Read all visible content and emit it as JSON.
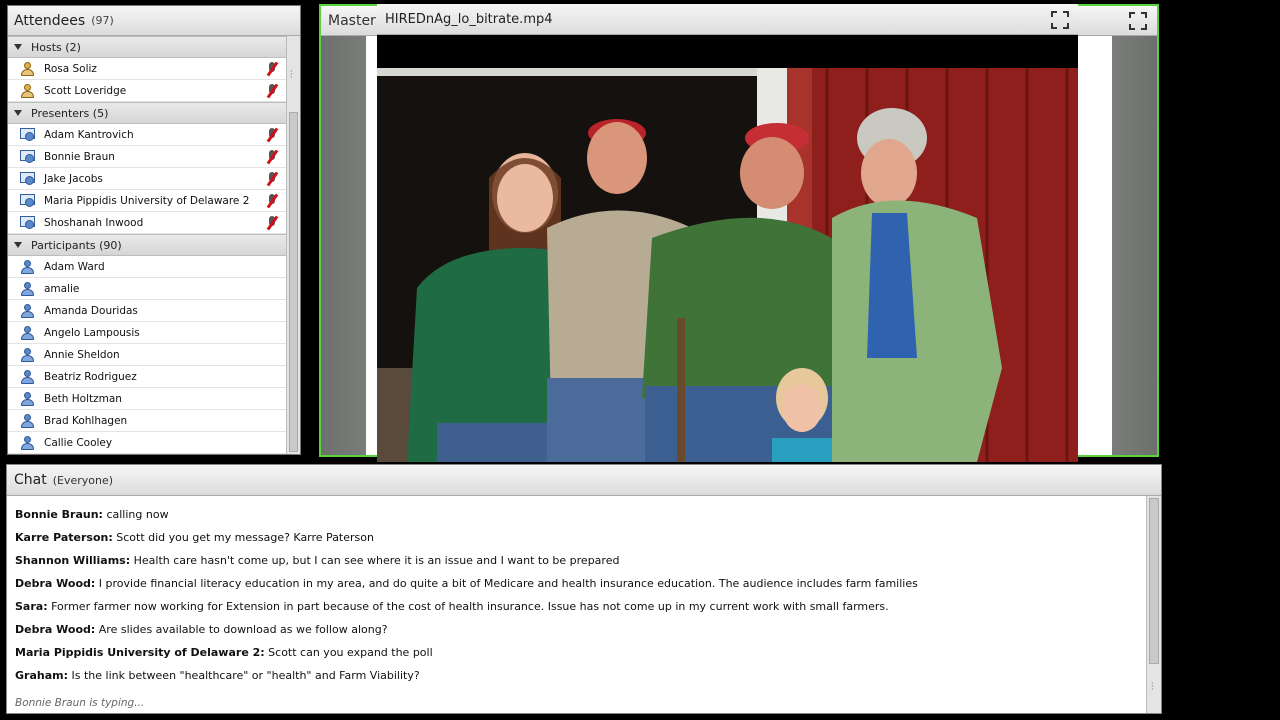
{
  "attendees": {
    "title": "Attendees",
    "count": "(97)",
    "groups": [
      {
        "label": "Hosts (2)",
        "role": "host",
        "people": [
          "Rosa Soliz",
          "Scott Loveridge"
        ]
      },
      {
        "label": "Presenters (5)",
        "role": "presenter",
        "people": [
          "Adam Kantrovich",
          "Bonnie Braun",
          "Jake Jacobs",
          "Maria Pippidis University of Delaware 2",
          "Shoshanah Inwood"
        ]
      },
      {
        "label": "Participants (90)",
        "role": "participant",
        "people": [
          "Adam Ward",
          "amalie",
          "Amanda Douridas",
          "Angelo Lampousis",
          "Annie Sheldon",
          "Beatriz Rodriguez",
          "Beth Holtzman",
          "Brad Kohlhagen",
          "Callie Cooley"
        ]
      }
    ]
  },
  "share_pod": {
    "title": "Master"
  },
  "video": {
    "title": "HIREDnAg_lo_bitrate.mp4"
  },
  "chat": {
    "title": "Chat",
    "scope": "(Everyone)",
    "messages": [
      {
        "sender": "Bonnie Braun:",
        "text": " calling now"
      },
      {
        "sender": "Karre Paterson:",
        "text": " Scott did you get my message?  Karre Paterson"
      },
      {
        "sender": "Shannon Williams:",
        "text": " Health care hasn't come up, but I can see where it is an issue and I want to be prepared"
      },
      {
        "sender": "Debra Wood:",
        "text": " I provide financial literacy education in my area, and do quite a bit of Medicare and health insurance education. The audience includes farm families"
      },
      {
        "sender": "Sara:",
        "text": " Former farmer now working for Extension in part because of the cost of health insurance. Issue has not come up in my current work with small farmers."
      },
      {
        "sender": "Debra Wood:",
        "text": " Are slides available to download as we follow along?"
      },
      {
        "sender": "Maria Pippidis University of Delaware 2:",
        "text": " Scott can you expand the poll"
      },
      {
        "sender": "Graham:",
        "text": " Is the link between \"healthcare\" or \"health\" and Farm Viability?"
      }
    ],
    "typing": "Bonnie Braun is typing..."
  }
}
